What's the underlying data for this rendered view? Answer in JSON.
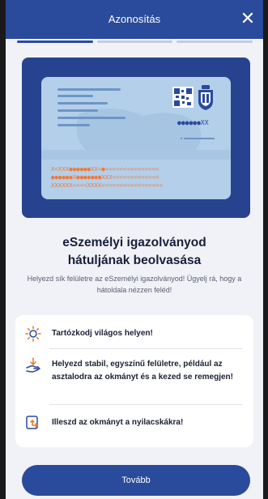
{
  "header": {
    "title": "Azonosítás",
    "close_icon": "close-icon"
  },
  "progress": {
    "total_steps": 3,
    "current_step": 1
  },
  "illustration": {
    "card_number": "●●●●●●XX",
    "mrz_lines": [
      "X<XXX●●●●●●XX<●<<<<<<<<<<<<<<<",
      "●●●●●●X●●●●●●●XXX<<<<<<<<<<<<<",
      "XXXXXX<<<<XXXX<<<<<<<<<<<<<<<<<"
    ]
  },
  "content": {
    "title_line1": "eSzemélyi igazolványod",
    "title_line2": "hátuljának beolvasása",
    "subtitle": "Helyezd sík felületre az eSzemélyi igazolványod! Ügyelj rá, hogy a hátoldala nézzen feléd!"
  },
  "tips": [
    {
      "icon": "sun-icon",
      "text": "Tartózkodj világos helyen!"
    },
    {
      "icon": "hand-placing-icon",
      "text": "Helyezd stabil, egyszínű felületre, például az asztalodra az okmányt és a kezed se remegjen!"
    },
    {
      "icon": "document-arrow-icon",
      "text": "Illeszd az okmányt a nyilacskákra!"
    }
  ],
  "footer": {
    "next_label": "Tovább"
  },
  "colors": {
    "brand": "#2a4a9b",
    "illustration_bg": "#27438f",
    "card": "#b3cfe9",
    "mrz": "#f07a3a",
    "icon": "#2a4a9b"
  }
}
